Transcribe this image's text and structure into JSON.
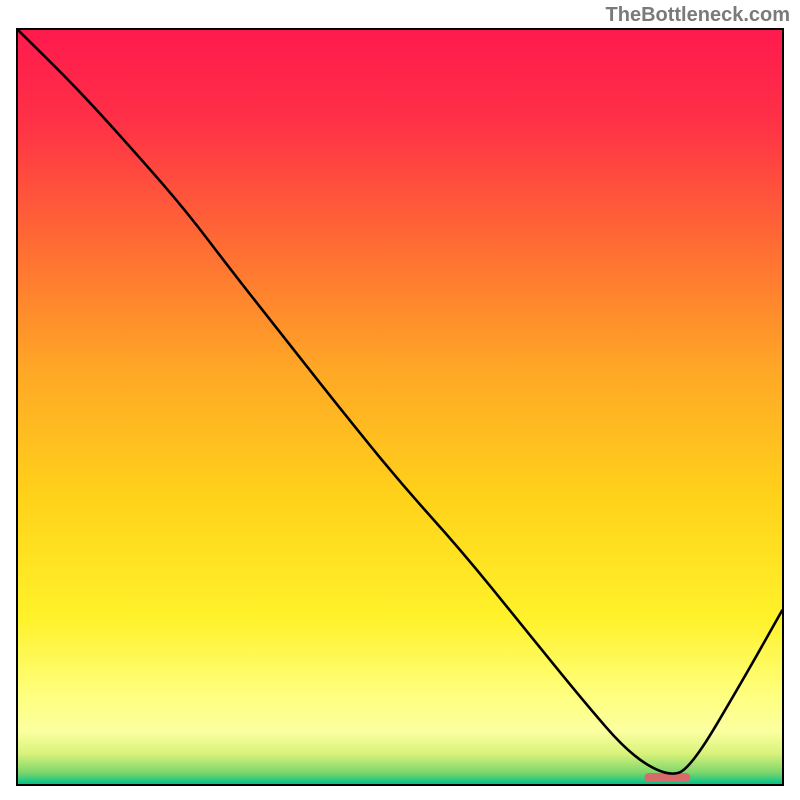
{
  "attribution": "TheBottleneck.com",
  "chart_data": {
    "type": "line",
    "title": "",
    "xlabel": "",
    "ylabel": "",
    "xlim": [
      0,
      100
    ],
    "ylim": [
      0,
      100
    ],
    "grid": false,
    "legend": false,
    "gradient_stops": [
      {
        "offset": 0.0,
        "color": "#ff1a4d"
      },
      {
        "offset": 0.12,
        "color": "#ff3047"
      },
      {
        "offset": 0.28,
        "color": "#ff6a34"
      },
      {
        "offset": 0.45,
        "color": "#ffa726"
      },
      {
        "offset": 0.62,
        "color": "#ffd21a"
      },
      {
        "offset": 0.78,
        "color": "#fff22a"
      },
      {
        "offset": 0.88,
        "color": "#ffff7d"
      },
      {
        "offset": 0.93,
        "color": "#fbffa0"
      },
      {
        "offset": 0.96,
        "color": "#d8f27a"
      },
      {
        "offset": 0.985,
        "color": "#7cd66b"
      },
      {
        "offset": 1.0,
        "color": "#00c28a"
      }
    ],
    "series": [
      {
        "name": "curve",
        "type": "line",
        "color": "#000000",
        "x": [
          0,
          8,
          16,
          22,
          28,
          35,
          42,
          50,
          58,
          66,
          74,
          80,
          85,
          88,
          95,
          100
        ],
        "values": [
          100,
          92,
          83,
          76,
          68,
          59,
          50,
          40,
          31,
          21,
          11,
          4,
          1,
          2,
          14,
          23
        ]
      },
      {
        "name": "marker",
        "type": "bar",
        "color": "#d86a6a",
        "x": [
          82,
          88
        ],
        "values": [
          1.2,
          1.2
        ]
      }
    ]
  }
}
